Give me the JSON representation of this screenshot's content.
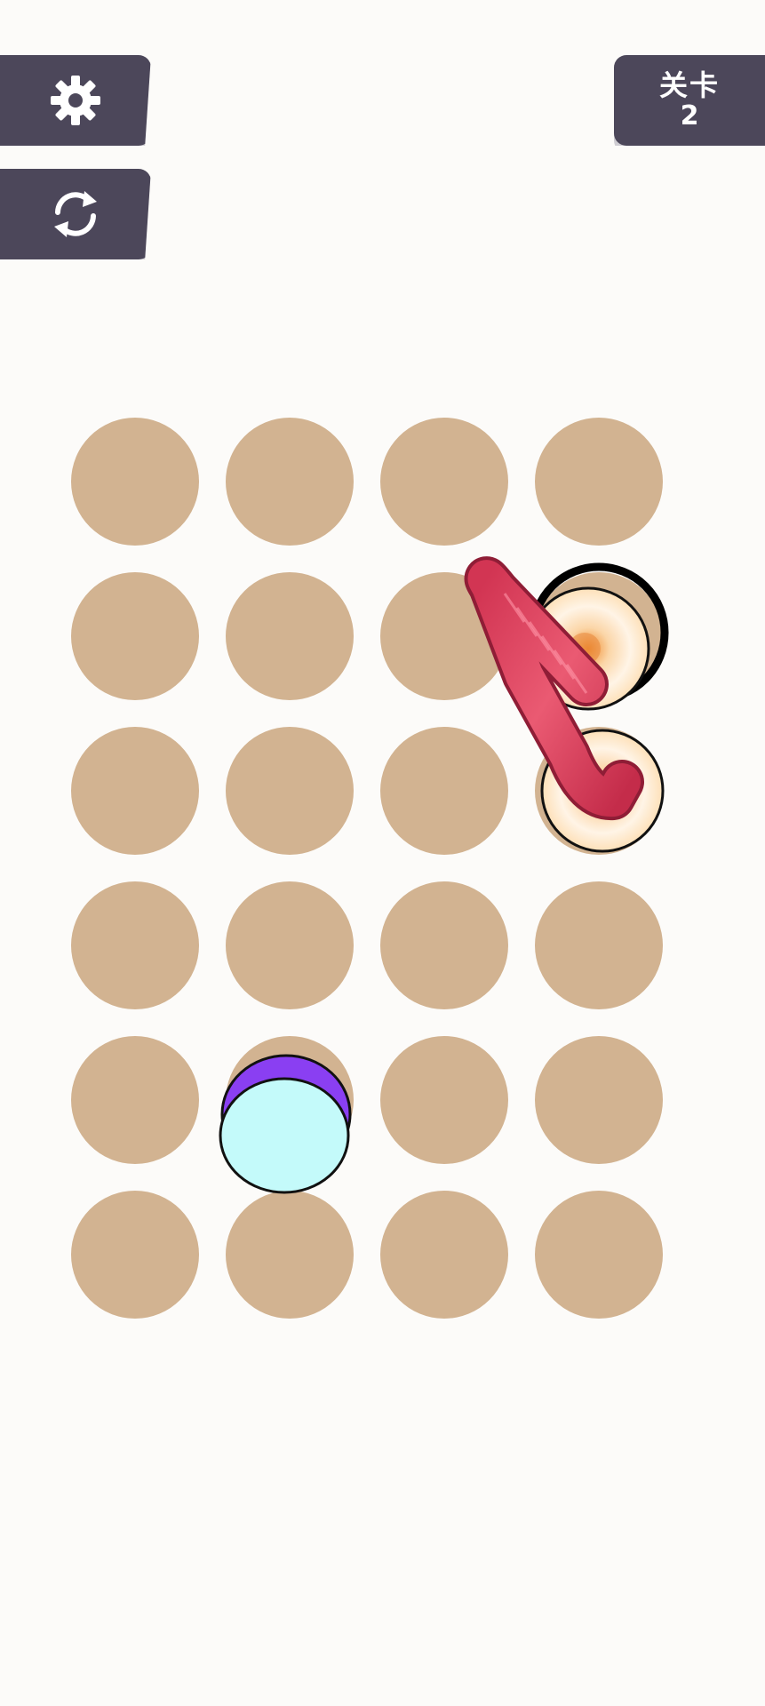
{
  "hud": {
    "settings_icon": "gear-icon",
    "restart_icon": "restart-icon",
    "level_label": "关卡",
    "level_number": "2"
  },
  "board": {
    "rows": 6,
    "cols": 4,
    "hole_color": "#d2b391",
    "pieces": [
      {
        "type": "ring",
        "color": "#fce9d4",
        "outline": "#111111",
        "row": 1,
        "col": 3
      },
      {
        "type": "ring",
        "color": "#fce9d4",
        "outline": "#111111",
        "row": 2,
        "col": 3
      },
      {
        "type": "rope",
        "color": "#e44a64",
        "from": [
          1,
          3
        ],
        "to": [
          2,
          3
        ]
      },
      {
        "type": "cap",
        "color": "#c4fafa",
        "rim": "#8a3ff2",
        "row": 4,
        "col": 1
      }
    ],
    "selected_hole": {
      "row": 1,
      "col": 3,
      "ring_color": "#000000"
    }
  },
  "colors": {
    "background": "#fcfbf9",
    "hud": "#4c475a",
    "hud_shadow": "#cfcdd3"
  }
}
